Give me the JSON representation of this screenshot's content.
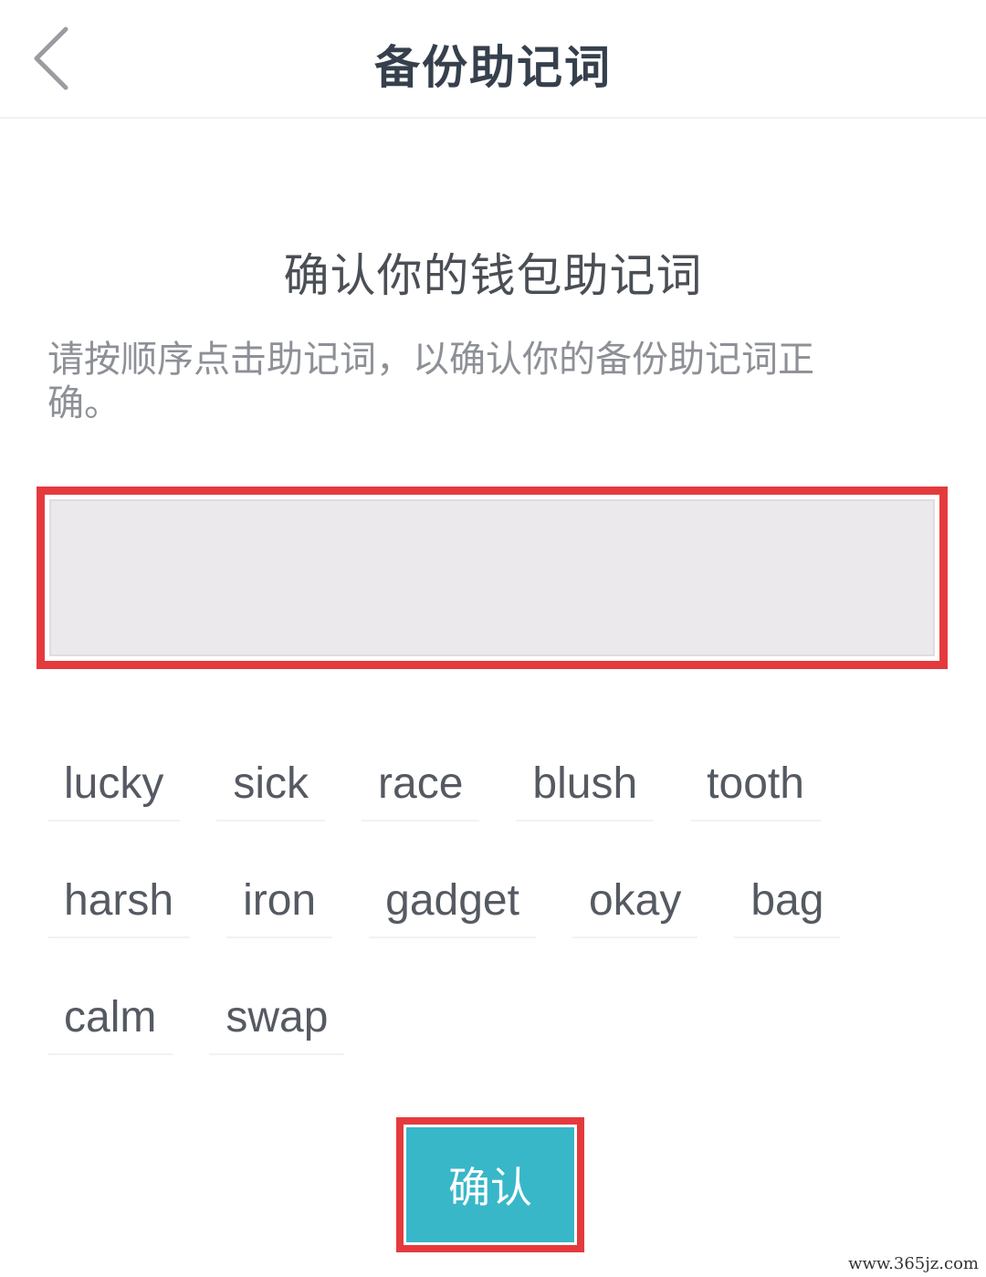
{
  "navbar": {
    "back_icon": "chevron-left-icon",
    "title": "备份助记词"
  },
  "main": {
    "heading": "确认你的钱包助记词",
    "instruction_line1": "请按顺序点击助记词，以确认你的备份助记词正",
    "instruction_line2": "确。"
  },
  "words": {
    "row1": [
      "lucky",
      "sick",
      "race",
      "blush",
      "tooth"
    ],
    "row2": [
      "harsh",
      "iron",
      "gadget",
      "okay",
      "bag"
    ],
    "row3": [
      "calm",
      "swap"
    ]
  },
  "confirm_label": "确认",
  "watermark": "www.365jz.com",
  "colors": {
    "highlight": "#e53a3d",
    "button": "#38b7c8",
    "selected_area": "#ece9ec"
  }
}
